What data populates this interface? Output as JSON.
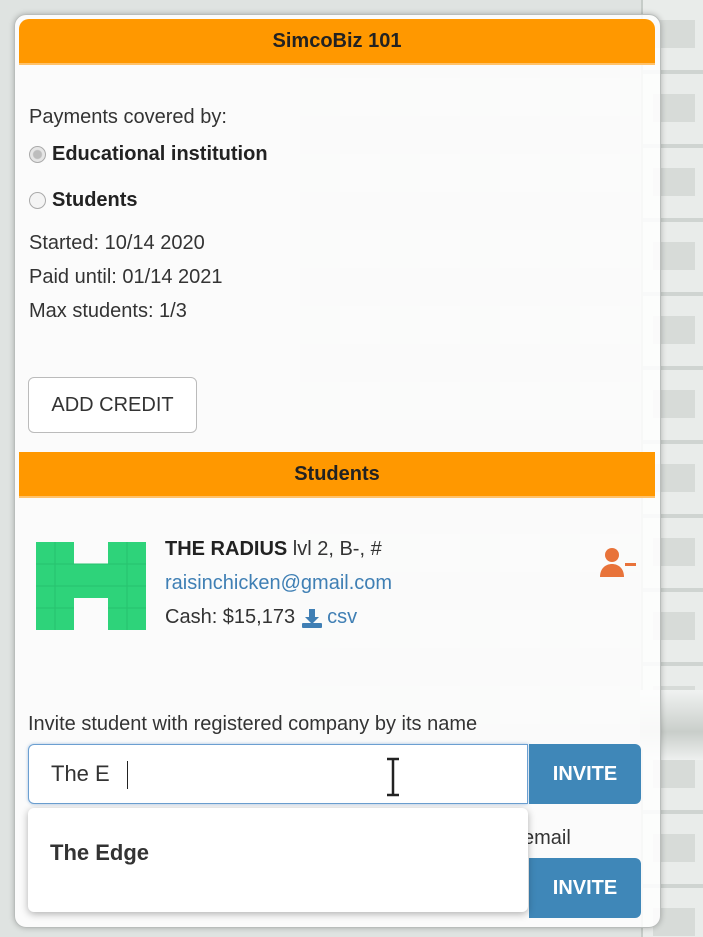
{
  "course": {
    "title": "SimcoBiz 101"
  },
  "payments": {
    "label": "Payments covered by:",
    "options": [
      "Educational institution",
      "Students"
    ],
    "selected": "Educational institution"
  },
  "info": {
    "started": "Started: 10/14 2020",
    "paid_until": "Paid until: 01/14 2021",
    "max_students": "Max students: 1/3"
  },
  "add_credit_label": "ADD CREDIT",
  "students_header": "Students",
  "student": {
    "name": "THE RADIUS",
    "meta": " lvl 2, B-, #",
    "email": "raisinchicken@gmail.com",
    "cash": "Cash: $15,173",
    "csv_label": "csv"
  },
  "invite": {
    "label": "Invite student with registered company by its name",
    "input_value": "The E",
    "button": "INVITE",
    "suggestion": "The Edge",
    "email_label_fragment": "email",
    "email_button": "INVITE"
  },
  "colors": {
    "header": "#ff9800",
    "button": "#3f87b8",
    "link": "#3f7fb4",
    "logo": "#2ed37a",
    "remove": "#e8733a"
  }
}
